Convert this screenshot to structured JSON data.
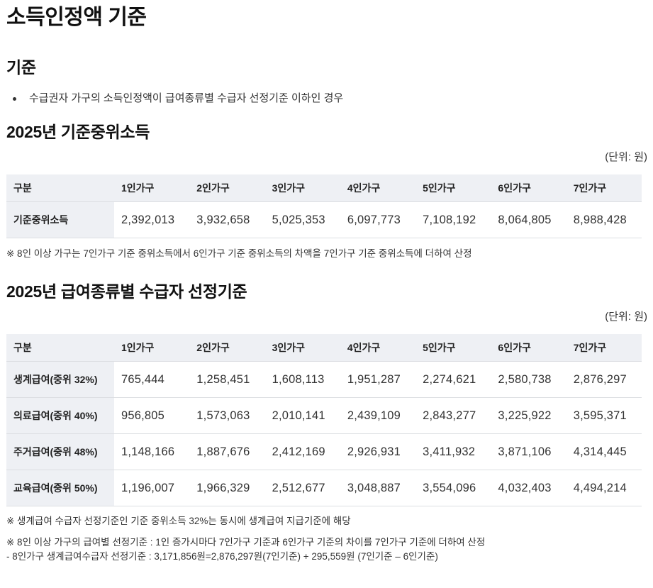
{
  "page_title": "소득인정액 기준",
  "criteria": {
    "heading": "기준",
    "bullets": [
      "수급권자 가구의 소득인정액이 급여종류별 수급자 선정기준 이하인 경우"
    ]
  },
  "median_income": {
    "heading": "2025년 기준중위소득",
    "unit": "(단위: 원)",
    "header": [
      "구분",
      "1인가구",
      "2인가구",
      "3인가구",
      "4인가구",
      "5인가구",
      "6인가구",
      "7인가구"
    ],
    "rows": [
      {
        "label": "기준중위소득",
        "values": [
          "2,392,013",
          "3,932,658",
          "5,025,353",
          "6,097,773",
          "7,108,192",
          "8,064,805",
          "8,988,428"
        ]
      }
    ],
    "note": "※ 8인 이상 가구는 7인가구 기준 중위소득에서 6인가구 기준 중위소득의 차액을 7인가구 기준 중위소득에 더하여 산정"
  },
  "benefit_criteria": {
    "heading": "2025년 급여종류별 수급자 선정기준",
    "unit": "(단위: 원)",
    "header": [
      "구분",
      "1인가구",
      "2인가구",
      "3인가구",
      "4인가구",
      "5인가구",
      "6인가구",
      "7인가구"
    ],
    "rows": [
      {
        "label": "생계급여(중위 32%)",
        "values": [
          "765,444",
          "1,258,451",
          "1,608,113",
          "1,951,287",
          "2,274,621",
          "2,580,738",
          "2,876,297"
        ]
      },
      {
        "label": "의료급여(중위 40%)",
        "values": [
          "956,805",
          "1,573,063",
          "2,010,141",
          "2,439,109",
          "2,843,277",
          "3,225,922",
          "3,595,371"
        ]
      },
      {
        "label": "주거급여(중위 48%)",
        "values": [
          "1,148,166",
          "1,887,676",
          "2,412,169",
          "2,926,931",
          "3,411,932",
          "3,871,106",
          "4,314,445"
        ]
      },
      {
        "label": "교육급여(중위 50%)",
        "values": [
          "1,196,007",
          "1,966,329",
          "2,512,677",
          "3,048,887",
          "3,554,096",
          "4,032,403",
          "4,494,214"
        ]
      }
    ],
    "note1": "※ 생계급여 수급자 선정기준인 기준 중위소득 32%는 동시에 생계급여 지급기준에 해당",
    "note2_line1": "※ 8인 이상 가구의 급여별 선정기준 : 1인 증가시마다 7인가구 기준과 6인가구 기준의 차이를 7인가구 기준에 더하여 산정",
    "note2_line2": "- 8인가구 생계급여수급자 선정기준 : 3,171,856원=2,876,297원(7인기준) + 295,559원 (7인기준 – 6인기준)"
  }
}
